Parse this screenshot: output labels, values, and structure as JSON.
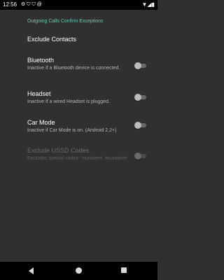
{
  "status_bar": {
    "time": "12:56",
    "left_icons": [
      "gear-icon",
      "shield-icon",
      "shield-icon",
      "at-icon"
    ],
    "right_icons": [
      "wifi-icon",
      "signal-icon",
      "battery-icon"
    ]
  },
  "section": {
    "header": "Outgoing Calls Confirm Exceptions",
    "header_color": "#6fc2b3"
  },
  "prefs": {
    "exclude_contacts": {
      "title": "Exclude Contacts"
    },
    "bluetooth": {
      "title": "Bluetooth",
      "summary": "Inactive if a Bluetooth device is connected.",
      "checked": false
    },
    "headset": {
      "title": "Headset",
      "summary": "Inactive if a wired Headset is plugged.",
      "checked": false
    },
    "car_mode": {
      "title": "Car Mode",
      "summary": "Inactive if Car Mode is on. (Android 2.2+)",
      "checked": false
    },
    "exclude_ussd": {
      "title": "Exclude USSD Codes",
      "summary": "Excludes special codes: *number#, #number#",
      "checked": false,
      "enabled": false
    }
  },
  "nav_bar": {
    "icons": [
      "back-icon",
      "home-icon",
      "recents-icon"
    ]
  }
}
